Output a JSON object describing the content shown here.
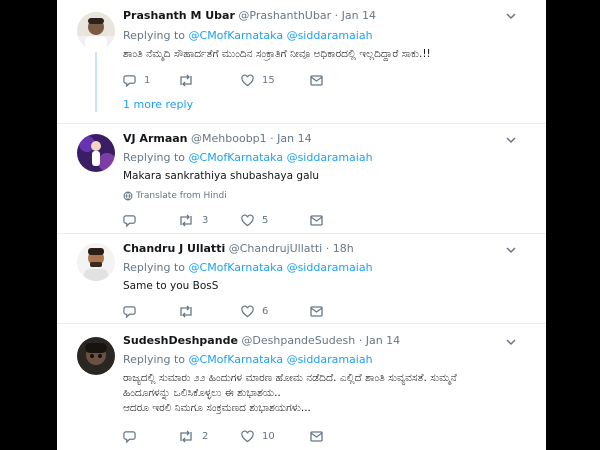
{
  "replies_prefix": "Replying to",
  "tweets": [
    {
      "name": "Prashanth M Ubar",
      "handle": "@PrashanthUbar",
      "dot": "·",
      "time": "Jan 14",
      "mentions": [
        "@CMofKarnataka",
        "@siddaramaiah"
      ],
      "text": "ಶಾಂತಿ ನೆಮ್ಮದಿ ಸೌಹಾರ್ದತೆಗೆ ಮುಂದಿನ ಸಂಕ್ರಾತಿಗೆ ನೀವೂ ಅಧಿಕಾರದಲ್ಲಿ ಇಲ್ಲದಿದ್ದಾರೆ ಸಾಕು.!!",
      "replies": "1",
      "retweets": "",
      "likes": "15",
      "more_replies": "1 more reply"
    },
    {
      "name": "VJ Armaan",
      "handle": "@Mehboobp1",
      "dot": "·",
      "time": "Jan 14",
      "mentions": [
        "@CMofKarnataka",
        "@siddaramaiah"
      ],
      "text": "Makara sankrathiya shubashaya galu",
      "translate": "Translate from Hindi",
      "replies": "",
      "retweets": "3",
      "likes": "5"
    },
    {
      "name": "Chandru J Ullatti",
      "handle": "@ChandrujUllatti",
      "dot": "·",
      "time": "18h",
      "mentions": [
        "@CMofKarnataka",
        "@siddaramaiah"
      ],
      "text": "Same to you BosS",
      "replies": "",
      "retweets": "",
      "likes": "6"
    },
    {
      "name": "SudeshDeshpande",
      "handle": "@DeshpandeSudesh",
      "dot": "·",
      "time": "Jan 14",
      "mentions": [
        "@CMofKarnataka",
        "@siddaramaiah"
      ],
      "text_lines": [
        "ರಾಜ್ಯದಲ್ಲಿ ಸುಮಾರು ೨೨ ಹಿಂದುಗಳ ಮಾರಣ ಹೋಮ ನಡೆದಿದೆ. ಎಲ್ಲಿದೆ ಶಾಂತಿ ಸುವ್ಯವಸತೆ. ಸುಮ್ಮನೆ",
        "ಹಿಂದೂಗಳನ್ನು ಒಲಿಸಿಕೊಳ್ಳಲು ಈ ಶುಭಾಶಯ..",
        "ಆದರೂ ಇರಲಿ ನಿಮಗೂ ಸಂಕ್ರಮಣದ ಶುಭಾಶಯಗಳು..."
      ],
      "replies": "",
      "retweets": "2",
      "likes": "10"
    }
  ],
  "colors": {
    "accent": "#1da1f2",
    "muted": "#657786",
    "text": "#14171a",
    "divider": "#e6ecf0",
    "thread": "#c8e3f5"
  },
  "icons": [
    "reply-icon",
    "retweet-icon",
    "like-icon",
    "message-icon",
    "chevron-down-icon",
    "translate-globe-icon"
  ]
}
